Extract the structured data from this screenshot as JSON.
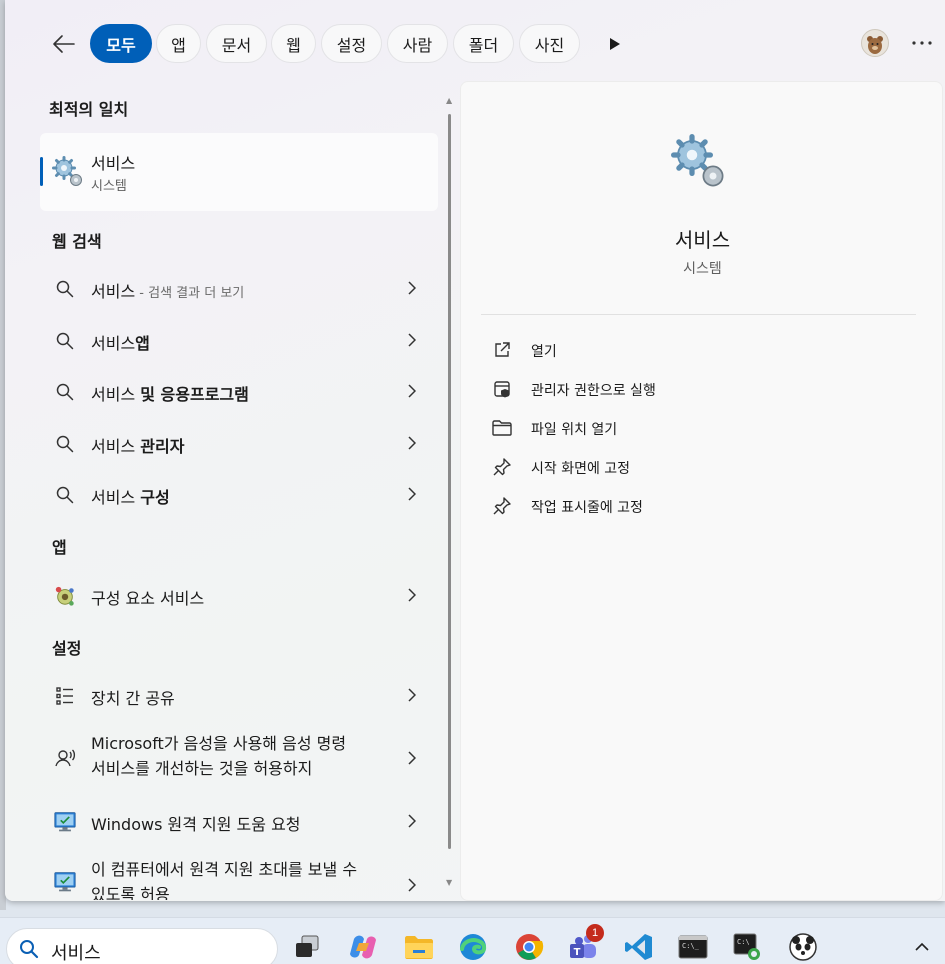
{
  "filter_bar": {
    "chips": [
      {
        "label": "모두",
        "active": true
      },
      {
        "label": "앱"
      },
      {
        "label": "문서"
      },
      {
        "label": "웹"
      },
      {
        "label": "설정"
      },
      {
        "label": "사람"
      },
      {
        "label": "폴더"
      },
      {
        "label": "사진"
      }
    ]
  },
  "best_match": {
    "section_title": "최적의 일치",
    "title": "서비스",
    "subtitle": "시스템"
  },
  "web_search": {
    "section_title": "웹 검색",
    "items": [
      {
        "prefix": "서비스",
        "suffix": " - 검색 결과 더 보기",
        "bold": ""
      },
      {
        "prefix": "서비스",
        "bold": "앱"
      },
      {
        "prefix": "서비스 ",
        "bold": "및 응용프로그램"
      },
      {
        "prefix": "서비스 ",
        "bold": "관리자"
      },
      {
        "prefix": "서비스 ",
        "bold": "구성"
      }
    ]
  },
  "apps": {
    "section_title": "앱",
    "items": [
      {
        "label": "구성 요소 서비스"
      }
    ]
  },
  "settings": {
    "section_title": "설정",
    "items": [
      {
        "label": "장치 간 공유"
      },
      {
        "label": "Microsoft가 음성을 사용해 음성 명령 서비스를 개선하는 것을 허용하지"
      },
      {
        "label": "Windows 원격 지원 도움 요청"
      },
      {
        "label": "이 컴퓨터에서 원격 지원 초대를 보낼 수 있도록 허용"
      }
    ]
  },
  "detail": {
    "title": "서비스",
    "type": "시스템",
    "actions": [
      {
        "label": "열기",
        "icon": "open-external-icon"
      },
      {
        "label": "관리자 권한으로 실행",
        "icon": "run-as-admin-icon"
      },
      {
        "label": "파일 위치 열기",
        "icon": "folder-icon"
      },
      {
        "label": "시작 화면에 고정",
        "icon": "pin-icon"
      },
      {
        "label": "작업 표시줄에 고정",
        "icon": "pin-icon"
      }
    ]
  },
  "taskbar": {
    "search_text": "서비스",
    "teams_badge": "1"
  },
  "colors": {
    "accent": "#005fb8",
    "badge": "#c42b1c"
  }
}
